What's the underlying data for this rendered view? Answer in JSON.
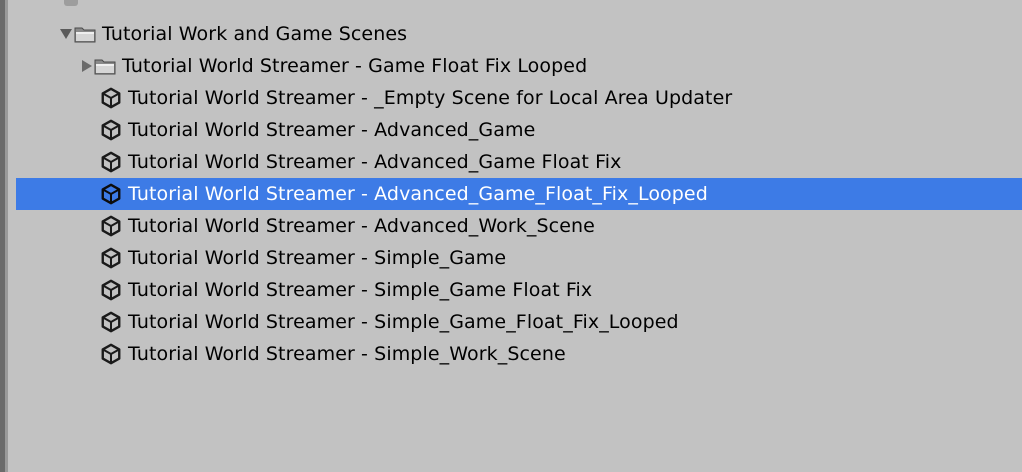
{
  "tree": {
    "root": {
      "label": "Tutorial Work and Game Scenes",
      "icon": "folder-icon",
      "expanded": true
    },
    "children": [
      {
        "label": "Tutorial World Streamer - Game Float Fix Looped",
        "type": "folder",
        "icon": "folder-icon",
        "expanded": false,
        "selected": false
      },
      {
        "label": "Tutorial World Streamer - _Empty Scene for Local Area Updater",
        "type": "scene",
        "icon": "unity-scene-icon",
        "selected": false
      },
      {
        "label": "Tutorial World Streamer - Advanced_Game",
        "type": "scene",
        "icon": "unity-scene-icon",
        "selected": false
      },
      {
        "label": "Tutorial World Streamer - Advanced_Game Float Fix",
        "type": "scene",
        "icon": "unity-scene-icon",
        "selected": false
      },
      {
        "label": "Tutorial World Streamer - Advanced_Game_Float_Fix_Looped",
        "type": "scene",
        "icon": "unity-scene-icon",
        "selected": true
      },
      {
        "label": "Tutorial World Streamer - Advanced_Work_Scene",
        "type": "scene",
        "icon": "unity-scene-icon",
        "selected": false
      },
      {
        "label": "Tutorial World Streamer - Simple_Game",
        "type": "scene",
        "icon": "unity-scene-icon",
        "selected": false
      },
      {
        "label": "Tutorial World Streamer - Simple_Game Float Fix",
        "type": "scene",
        "icon": "unity-scene-icon",
        "selected": false
      },
      {
        "label": "Tutorial World Streamer - Simple_Game_Float_Fix_Looped",
        "type": "scene",
        "icon": "unity-scene-icon",
        "selected": false
      },
      {
        "label": "Tutorial World Streamer - Simple_Work_Scene",
        "type": "scene",
        "icon": "unity-scene-icon",
        "selected": false
      }
    ]
  },
  "colors": {
    "background": "#c2c2c2",
    "selection": "#3d7be6",
    "selected_text": "#ffffff",
    "text": "#000000"
  }
}
